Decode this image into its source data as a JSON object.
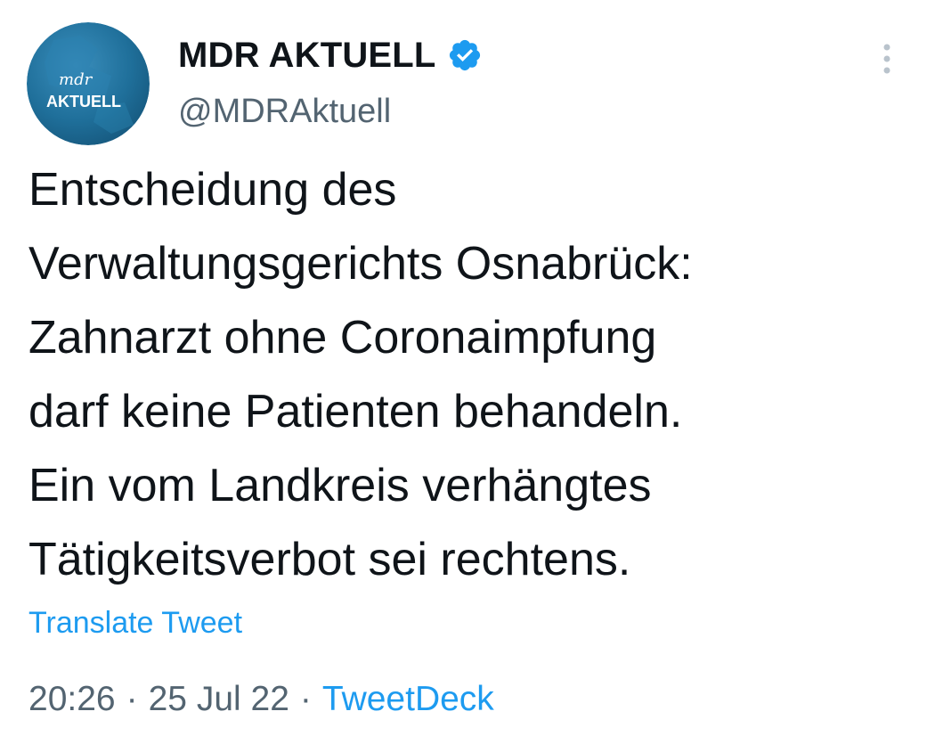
{
  "author": {
    "display_name": "MDR AKTUELL",
    "handle": "@MDRAktuell",
    "verified": true,
    "avatar_logo_top": "mdr",
    "avatar_logo_bottom": "AKTUELL"
  },
  "tweet": {
    "text": "Entscheidung des\nVerwaltungsgerichts Osnabrück:\nZahnarzt ohne Coronaimpfung\ndarf keine Patienten behandeln.\nEin vom Landkreis verhängtes\nTätigkeitsverbot sei rechtens.",
    "translate_label": "Translate Tweet"
  },
  "meta": {
    "time": "20:26",
    "separator": "·",
    "date": "25 Jul 22",
    "source": "TweetDeck"
  },
  "icons": {
    "verified": "verified-badge-icon",
    "more": "more-options-icon"
  },
  "colors": {
    "accent": "#1d9bf0",
    "text": "#0f1419",
    "secondary": "#536471",
    "avatar_bg": "#1f6f9a"
  }
}
